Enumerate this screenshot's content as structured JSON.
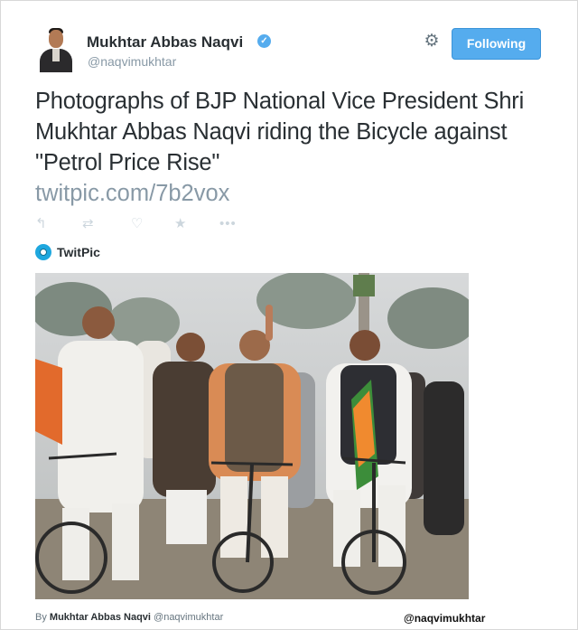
{
  "user": {
    "name": "Mukhtar Abbas Naqvi",
    "handle": "@naqvimukhtar",
    "verified_icon": "verified-badge-icon"
  },
  "header": {
    "follow_label": "Following",
    "settings_icon": "gear-icon"
  },
  "tweet": {
    "text": "Photographs of BJP National Vice President Shri Mukhtar Abbas Naqvi riding the Bicycle against \"Petrol Price Rise\"",
    "link": "twitpic.com/7b2vox"
  },
  "actions": {
    "icons": [
      "reply-icon",
      "retweet-icon",
      "favorite-icon",
      "star-icon",
      "more-icon"
    ]
  },
  "card": {
    "provider": "TwitPic"
  },
  "footer": {
    "by_prefix": "By",
    "by_name": "Mukhtar Abbas Naqvi",
    "by_handle": "@naqvimukhtar",
    "watermark": "@naqvimukhtar"
  },
  "colors": {
    "accent": "#55acee",
    "text": "#292f33",
    "muted": "#8899a6"
  }
}
